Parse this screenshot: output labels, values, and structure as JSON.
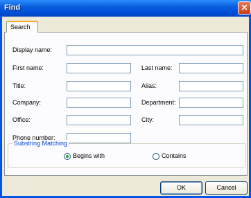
{
  "window": {
    "title": "Find",
    "close": "✕"
  },
  "tabs": [
    {
      "label": "Search"
    }
  ],
  "form": {
    "display_name": {
      "label": "Display name:",
      "value": ""
    },
    "first_name": {
      "label": "First name:",
      "value": ""
    },
    "last_name": {
      "label": "Last name:",
      "value": ""
    },
    "title": {
      "label": "Title:",
      "value": ""
    },
    "alias": {
      "label": "Alias:",
      "value": ""
    },
    "company": {
      "label": "Company:",
      "value": ""
    },
    "department": {
      "label": "Department:",
      "value": ""
    },
    "office": {
      "label": "Office:",
      "value": ""
    },
    "city": {
      "label": "City:",
      "value": ""
    },
    "phone_number": {
      "label": "Phone number:",
      "value": ""
    }
  },
  "substring": {
    "title": "Substring Matching",
    "options": [
      {
        "label": "Begins with",
        "selected": true
      },
      {
        "label": "Contains",
        "selected": false
      }
    ]
  },
  "buttons": {
    "ok": "OK",
    "cancel": "Cancel"
  },
  "colors": {
    "title_bar": "#0a5fdc",
    "close_button": "#cc3d14",
    "group_title": "#0046d5",
    "client_bg": "#ece9d8"
  }
}
